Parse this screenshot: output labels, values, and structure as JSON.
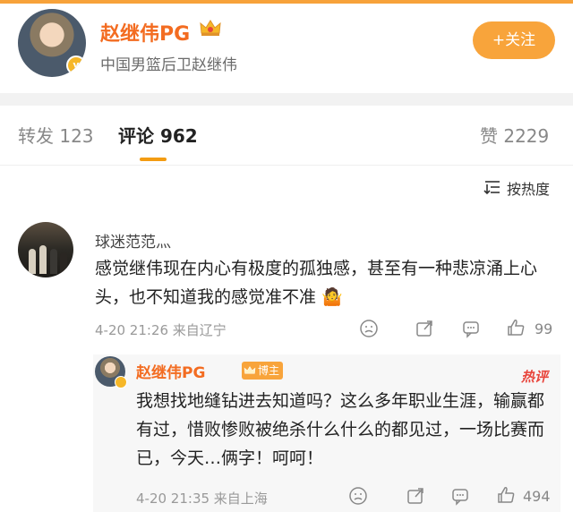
{
  "profile": {
    "name": "赵继伟PG",
    "subtitle": "中国男篮后卫赵继伟",
    "follow_label": "+关注",
    "verified_mark": "v"
  },
  "tabs": {
    "repost": "转发 123",
    "comments": "评论 962",
    "likes": "赞 2229"
  },
  "sort": {
    "label": "按热度"
  },
  "comment": {
    "user": "球迷范范灬",
    "text": "感觉继伟现在内心有极度的孤独感，甚至有一种悲凉涌上心头，也不知道我的感觉准不准",
    "emoji": "🤷",
    "meta": "4-20 21:26 来自辽宁",
    "like_count": "99"
  },
  "reply": {
    "user": "赵继伟PG",
    "tag": "博主",
    "hot_tag": "热评",
    "text": "我想找地缝钻进去知道吗？这么多年职业生涯，输赢都有过，惜败惨败被绝杀什么什么的都见过，一场比赛而已，今天…俩字！呵呵！",
    "meta": "4-20 21:35 来自上海",
    "like_count": "494"
  },
  "colors": {
    "accent": "#f8a43b",
    "name": "#f36c21",
    "hot": "#e8453c"
  },
  "icons": [
    "crown-icon",
    "sort-icon",
    "dislike-face-icon",
    "share-icon",
    "comment-icon",
    "like-icon"
  ]
}
